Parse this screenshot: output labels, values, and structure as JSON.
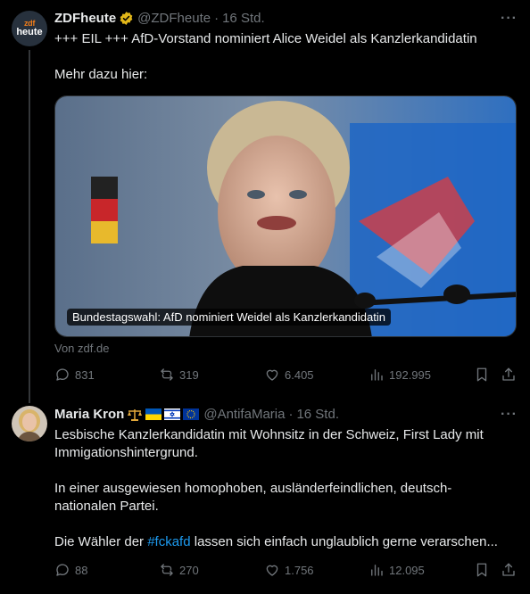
{
  "tweet1": {
    "avatar_line1": "zdf",
    "avatar_line2": "heute",
    "name": "ZDFheute",
    "handle": "@ZDFheute",
    "separator": "·",
    "time": "16 Std.",
    "text": "+++ EIL +++ AfD-Vorstand nominiert Alice Weidel als Kanzlerkandidatin\n\nMehr dazu hier:",
    "card_label": "Bundestagswahl: AfD nominiert Weidel als Kanzlerkandidatin",
    "source": "Von zdf.de",
    "replies": "831",
    "reposts": "319",
    "likes": "6.405",
    "views": "192.995"
  },
  "tweet2": {
    "name": "Maria Kron",
    "badge_icons": [
      "scales-icon",
      "ukraine-flag-icon",
      "israel-flag-icon",
      "eu-flag-icon"
    ],
    "handle": "@AntifaMaria",
    "separator": "·",
    "time": "16 Std.",
    "text_before_hashtag": "Lesbische Kanzlerkandidatin mit Wohnsitz in der Schweiz, First Lady mit Immigationshintergrund.\n\nIn einer ausgewiesen homophoben, ausländerfeindlichen, deutsch-nationalen Partei.\n\nDie Wähler der ",
    "hashtag": "#fckafd",
    "text_after_hashtag": " lassen sich einfach unglaublich gerne verarschen...",
    "replies": "88",
    "reposts": "270",
    "likes": "1.756",
    "views": "12.095"
  },
  "more_label": "···",
  "colors": {
    "background": "#000000",
    "text": "#e7e9ea",
    "secondary": "#71767b",
    "link": "#1d9bf0",
    "verified_gold": "#e2b719"
  }
}
